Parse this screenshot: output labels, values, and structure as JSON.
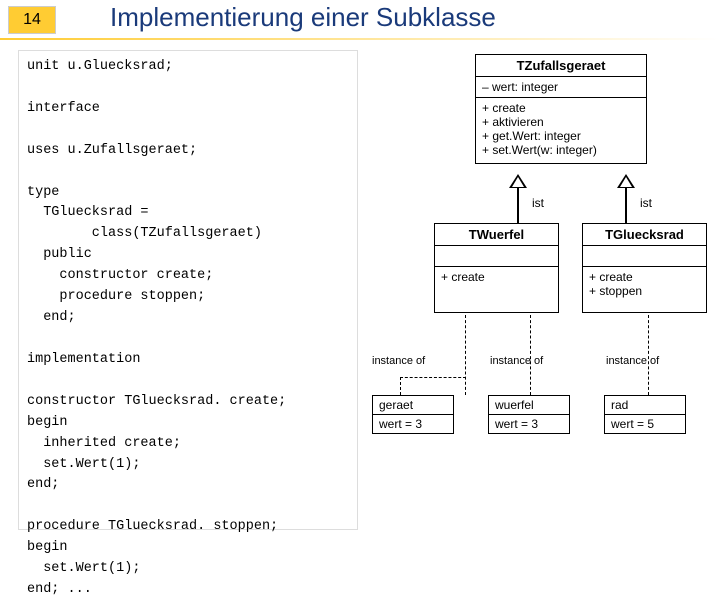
{
  "slide": {
    "number": "14",
    "title": "Implementierung einer Subklasse"
  },
  "code": {
    "l1": "unit u.Gluecksrad;",
    "l2": "interface",
    "l3": "uses u.Zufallsgeraet;",
    "l4": "type",
    "l5": "  TGluecksrad =",
    "l6": "        class(TZufallsgeraet)",
    "l7": "  public",
    "l8": "    constructor create;",
    "l9": "    procedure stoppen;",
    "l10": "  end;",
    "l11": "implementation",
    "l12": "constructor TGluecksrad. create;",
    "l13": "begin",
    "l14": "  inherited create;",
    "l15": "  set.Wert(1);",
    "l16": "end;",
    "l17": "procedure TGluecksrad. stoppen;",
    "l18": "begin",
    "l19": "  set.Wert(1);",
    "l20": "end; ..."
  },
  "uml": {
    "super": {
      "name": "TZufallsgeraet",
      "attr1": "– wert: integer",
      "m1": "+ create",
      "m2": "+ aktivieren",
      "m3": "+ get.Wert: integer",
      "m4": "+ set.Wert(w: integer)"
    },
    "sub1": {
      "name": "TWuerfel",
      "m1": "+ create"
    },
    "sub2": {
      "name": "TGluecksrad",
      "m1": "+ create",
      "m2": "+ stoppen"
    },
    "ist": "ist",
    "instanceof": "instance of",
    "inst1": {
      "name": "geraet",
      "val": "wert = 3"
    },
    "inst2": {
      "name": "wuerfel",
      "val": "wert = 3"
    },
    "inst3": {
      "name": "rad",
      "val": "wert = 5"
    }
  }
}
